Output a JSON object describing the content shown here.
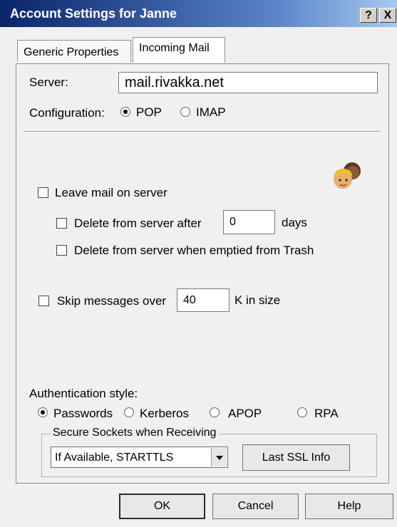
{
  "window": {
    "title": "Account Settings for Janne",
    "help_button": "?",
    "close_button": "X"
  },
  "tabs": [
    {
      "label": "Generic Properties"
    },
    {
      "label": "Incoming Mail"
    }
  ],
  "incoming": {
    "server_label": "Server:",
    "server_value": "mail.rivakka.net",
    "config_label": "Configuration:",
    "config_options": [
      "POP",
      "IMAP"
    ],
    "config_selected": "POP",
    "leave_mail_label": "Leave mail on server",
    "leave_mail_checked": false,
    "delete_after_label": "Delete from server after",
    "delete_after_value": "0",
    "days_label": "days",
    "delete_after_checked": false,
    "delete_trash_label": "Delete from server when emptied from Trash",
    "delete_trash_checked": false,
    "skip_label": "Skip messages over",
    "skip_value": "40",
    "skip_unit": "K in size",
    "skip_checked": false,
    "auth_label": "Authentication style:",
    "auth_options": [
      "Passwords",
      "Kerberos",
      "APOP",
      "RPA"
    ],
    "auth_selected": "Passwords",
    "ssl_group_label": "Secure Sockets when Receiving",
    "ssl_selected": "If Available, STARTTLS",
    "ssl_info_button": "Last SSL Info"
  },
  "buttons": {
    "ok": "OK",
    "cancel": "Cancel",
    "help": "Help"
  },
  "icons": {
    "personality": "people-icon",
    "dropdown": "chevron-down-icon"
  }
}
